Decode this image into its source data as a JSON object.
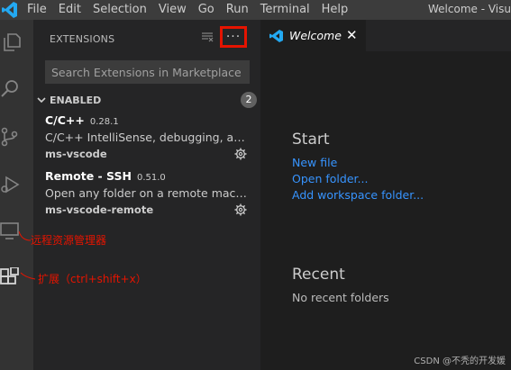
{
  "titlebar": {
    "menu": [
      "File",
      "Edit",
      "Selection",
      "View",
      "Go",
      "Run",
      "Terminal",
      "Help"
    ],
    "window_title": "Welcome - Visu"
  },
  "activity_bar": {
    "items": [
      "explorer-icon",
      "search-icon",
      "source-control-icon",
      "run-debug-icon",
      "remote-explorer-icon",
      "extensions-icon"
    ]
  },
  "sidebar": {
    "title": "EXTENSIONS",
    "more_label": "···",
    "search_placeholder": "Search Extensions in Marketplace",
    "section_label": "ENABLED",
    "section_count": "2",
    "extensions": [
      {
        "name": "C/C++",
        "version": "0.28.1",
        "description": "C/C++ IntelliSense, debugging, and c...",
        "publisher": "ms-vscode"
      },
      {
        "name": "Remote - SSH",
        "version": "0.51.0",
        "description": "Open any folder on a remote machine...",
        "publisher": "ms-vscode-remote"
      }
    ]
  },
  "editor": {
    "tab_label": "Welcome",
    "tab_close": "✕",
    "start_heading": "Start",
    "links": [
      "New file",
      "Open folder...",
      "Add workspace folder..."
    ],
    "recent_heading": "Recent",
    "no_recent": "No recent folders"
  },
  "annotations": {
    "remote_explorer": "远程资源管理器",
    "extensions": "扩展（ctrl+shift+x）"
  },
  "watermark": "CSDN @不秃的开发媛",
  "colors": {
    "accent_blue": "#3794ff",
    "annotation_red": "#e51400",
    "vscode_blue": "#23a9f2"
  }
}
